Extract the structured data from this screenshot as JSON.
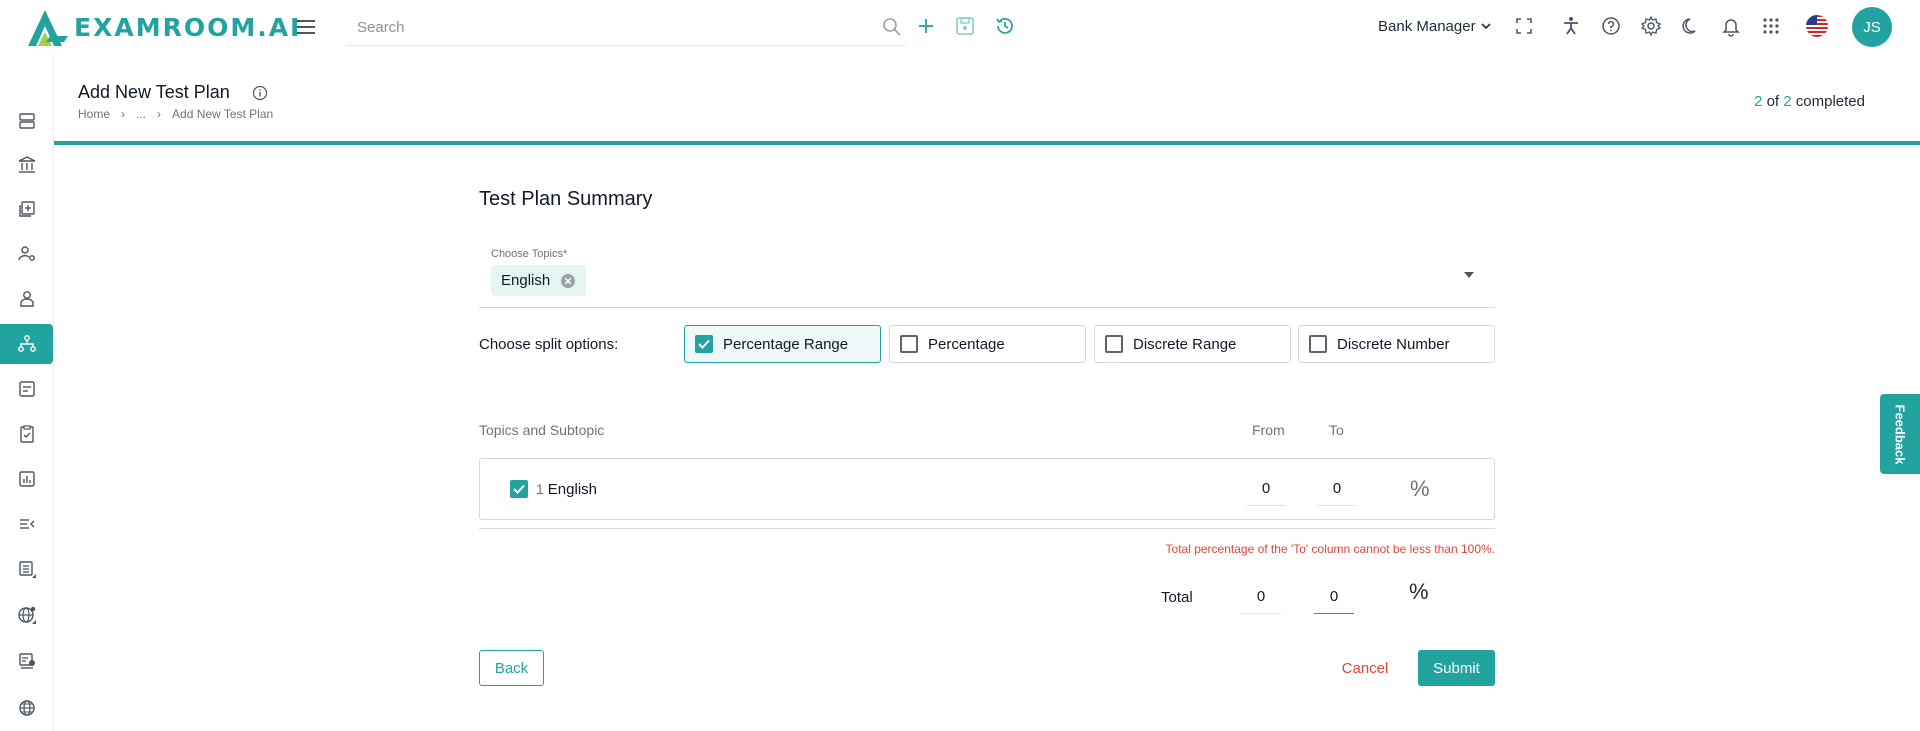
{
  "app": {
    "logo_text": "EXAMROOM.AI"
  },
  "topbar": {
    "search_placeholder": "Search",
    "role": "Bank Manager",
    "avatar_initials": "JS",
    "accent": "#22a3a0",
    "icons": [
      "search-icon",
      "add-icon",
      "save-icon",
      "history-icon",
      "fullscreen-icon",
      "accessibility-icon",
      "help-icon",
      "settings-icon",
      "dark-mode-icon",
      "notification-bell-icon",
      "apps-grid-icon",
      "us-flag-icon"
    ]
  },
  "sidebar": {
    "items": [
      {
        "icon": "server-icon",
        "active": false
      },
      {
        "icon": "bank-icon",
        "active": false
      },
      {
        "icon": "add-document-icon",
        "active": false
      },
      {
        "icon": "users-settings-icon",
        "active": false
      },
      {
        "icon": "user-icon",
        "active": false
      },
      {
        "icon": "hierarchy-icon",
        "active": true
      },
      {
        "icon": "notes-icon",
        "active": false
      },
      {
        "icon": "clipboard-check-icon",
        "active": false
      },
      {
        "icon": "bar-chart-icon",
        "active": false
      },
      {
        "icon": "list-collapse-icon",
        "active": false
      },
      {
        "icon": "list-expand-icon",
        "active": false
      },
      {
        "icon": "globe-settings-icon",
        "active": false
      },
      {
        "icon": "certificate-icon",
        "active": false
      },
      {
        "icon": "globe-icon",
        "active": false
      }
    ]
  },
  "page": {
    "title": "Add New Test Plan",
    "breadcrumb": [
      "Home",
      "...",
      "Add New Test Plan"
    ],
    "progress": {
      "current": "2",
      "of_text": "of",
      "total": "2",
      "suffix": "completed"
    }
  },
  "form": {
    "section_title": "Test Plan Summary",
    "topics_label": "Choose Topics*",
    "selected_topic": "English",
    "split_label": "Choose split options:",
    "split_options": [
      {
        "label": "Percentage Range",
        "checked": true
      },
      {
        "label": "Percentage",
        "checked": false
      },
      {
        "label": "Discrete Range",
        "checked": false
      },
      {
        "label": "Discrete Number",
        "checked": false
      }
    ],
    "table_headers": {
      "topics": "Topics and Subtopic",
      "from": "From",
      "to": "To"
    },
    "row": {
      "index": "1",
      "name": "English",
      "from": "0",
      "to": "0",
      "unit": "%",
      "checked": true
    },
    "error": "Total percentage of the 'To' column cannot be less than 100%.",
    "total": {
      "label": "Total",
      "from": "0",
      "to": "0",
      "unit": "%"
    }
  },
  "actions": {
    "back": "Back",
    "cancel": "Cancel",
    "submit": "Submit"
  },
  "feedback": "Feedback"
}
